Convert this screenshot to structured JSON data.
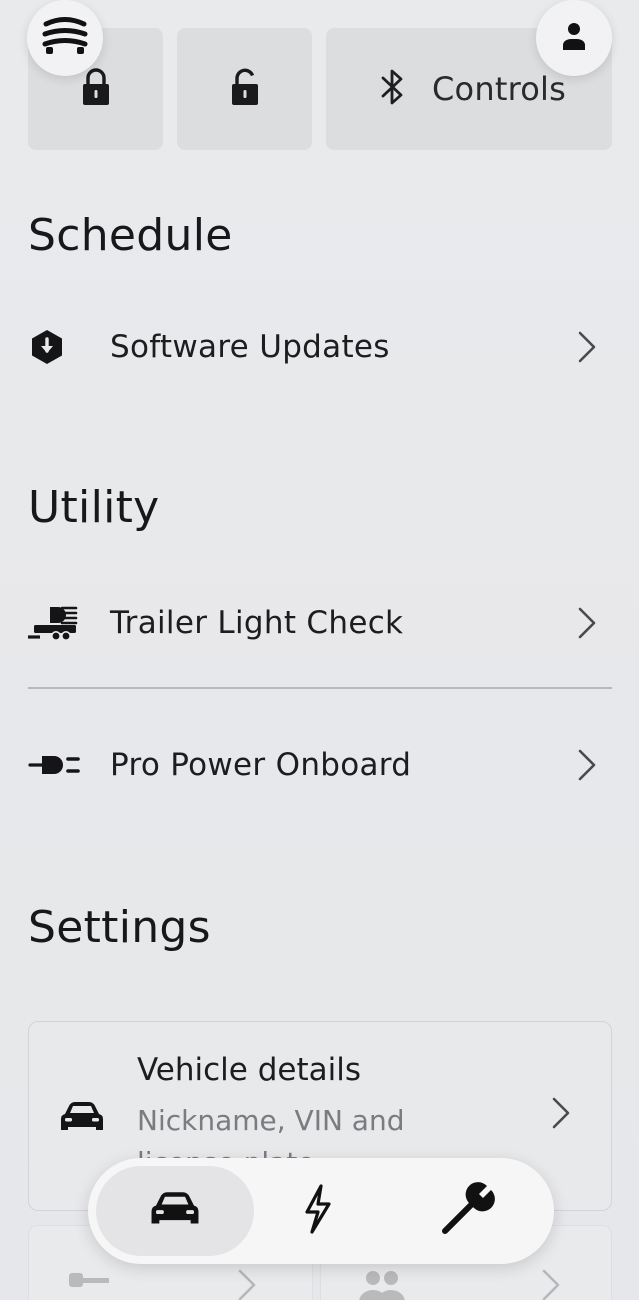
{
  "top": {
    "menu_icon": "vehicle-menu-icon",
    "profile_icon": "person-icon",
    "tiles": [
      {
        "name": "lock",
        "icon": "lock-icon"
      },
      {
        "name": "unlock",
        "icon": "unlock-icon"
      },
      {
        "name": "controls",
        "icon": "bluetooth-icon",
        "label": "Controls"
      }
    ]
  },
  "schedule": {
    "title": "Schedule",
    "items": [
      {
        "label": "Software Updates",
        "icon": "software-update-icon"
      }
    ]
  },
  "utility": {
    "title": "Utility",
    "items": [
      {
        "label": "Trailer Light Check",
        "icon": "trailer-light-icon"
      },
      {
        "label": "Pro Power Onboard",
        "icon": "power-plug-icon"
      }
    ]
  },
  "settings": {
    "title": "Settings",
    "vehicle_details": {
      "title": "Vehicle details",
      "subtitle": "Nickname, VIN and license plate",
      "icon": "car-icon"
    },
    "partial_items": [
      {
        "icon": "key-icon"
      },
      {
        "icon": "people-icon"
      }
    ]
  },
  "bottom_nav": {
    "items": [
      {
        "name": "vehicle",
        "icon": "car-icon",
        "active": true
      },
      {
        "name": "charge",
        "icon": "lightning-icon",
        "active": false
      },
      {
        "name": "service",
        "icon": "wrench-icon",
        "active": false
      }
    ]
  },
  "colors": {
    "background": "#e8e9eb",
    "tile": "#dcdddf",
    "text": "#1b1b1d",
    "muted_text": "#7b7b80",
    "nav_active": "#e4e4e6"
  }
}
